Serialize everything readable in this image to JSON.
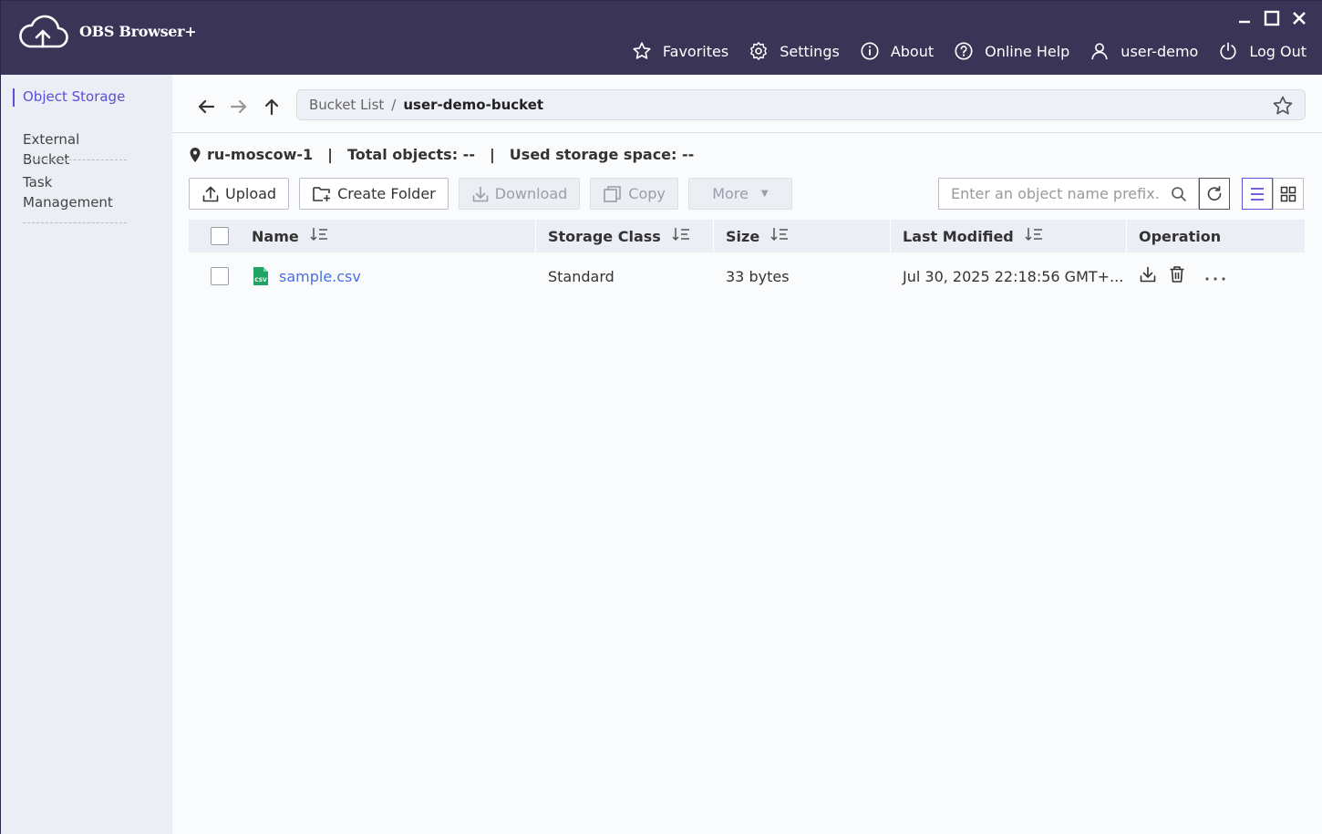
{
  "app": {
    "title": "OBS Browser+"
  },
  "window_controls": {
    "minimize": "minimize-icon",
    "maximize": "maximize-icon",
    "close": "close-icon"
  },
  "topnav": {
    "favorites": "Favorites",
    "settings": "Settings",
    "about": "About",
    "help": "Online Help",
    "user": "user-demo",
    "logout": "Log Out"
  },
  "sidebar": {
    "items": [
      {
        "label": "Object Storage",
        "active": true
      },
      {
        "label": "External Bucket",
        "active": false
      },
      {
        "label": "Task Management",
        "active": false
      }
    ]
  },
  "path": {
    "root": "Bucket List",
    "separator": "/",
    "current": "user-demo-bucket"
  },
  "info": {
    "region": "ru-moscow-1",
    "separator": "|",
    "total_objects": "Total objects: --",
    "used_storage": "Used storage space: --"
  },
  "toolbar": {
    "upload": "Upload",
    "create_folder": "Create Folder",
    "download": "Download",
    "copy": "Copy",
    "more": "More"
  },
  "search": {
    "placeholder": "Enter an object name prefix."
  },
  "table": {
    "columns": {
      "name": "Name",
      "storage_class": "Storage Class",
      "size": "Size",
      "last_modified": "Last Modified",
      "operation": "Operation"
    },
    "rows": [
      {
        "name": "sample.csv",
        "file_icon_text": "CSV",
        "storage_class": "Standard",
        "size": "33 bytes",
        "last_modified": "Jul 30, 2025 22:18:56 GMT+..."
      }
    ]
  },
  "colors": {
    "header_bg": "#3a3556",
    "accent": "#5a4fd6",
    "link": "#4a6fe0",
    "sidebar_bg": "#eceef5",
    "csv_icon": "#1fa463"
  }
}
